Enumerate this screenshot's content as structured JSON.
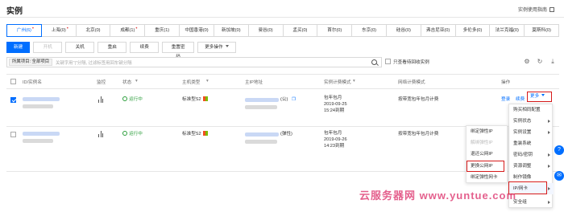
{
  "header": {
    "title": "实例",
    "guide_link": "实例使用指南"
  },
  "regions": [
    {
      "label": "广州(6)",
      "active": true,
      "dot": true
    },
    {
      "label": "上海(0)",
      "active": false,
      "dot": true
    },
    {
      "label": "北京(0)",
      "active": false,
      "dot": false
    },
    {
      "label": "成都(1)",
      "active": false,
      "dot": true
    },
    {
      "label": "重庆(1)",
      "active": false,
      "dot": false
    },
    {
      "label": "中国香港(0)",
      "active": false,
      "dot": false
    },
    {
      "label": "新加坡(0)",
      "active": false,
      "dot": false
    },
    {
      "label": "曼谷(0)",
      "active": false,
      "dot": false
    },
    {
      "label": "孟买(0)",
      "active": false,
      "dot": false
    },
    {
      "label": "首尔(0)",
      "active": false,
      "dot": false
    },
    {
      "label": "东京(0)",
      "active": false,
      "dot": false
    },
    {
      "label": "硅谷(0)",
      "active": false,
      "dot": false
    },
    {
      "label": "弗吉尼亚(0)",
      "active": false,
      "dot": false
    },
    {
      "label": "多伦多(0)",
      "active": false,
      "dot": false
    },
    {
      "label": "法兰克福(0)",
      "active": false,
      "dot": false
    },
    {
      "label": "莫斯科(0)",
      "active": false,
      "dot": false
    }
  ],
  "toolbar": {
    "new": "新建",
    "power_on": "开机",
    "power_off": "关机",
    "restart": "重启",
    "renew": "续费",
    "reset_password": "重置密码",
    "more_ops": "更多操作"
  },
  "filter": {
    "tag": "所属项目: 全部项目",
    "placeholder": "关键字用\"|\"分隔, 过滤标签用回车键分隔",
    "only_expire": "只查看待回收实例"
  },
  "table": {
    "headers": {
      "id_name": "ID/实例名",
      "monitor": "监控",
      "status": "状态",
      "host_type": "主机类型",
      "main_ip": "主IP地址",
      "billing": "实例计费模式",
      "network_billing": "网络计费模式",
      "actions": "操作"
    },
    "rows": [
      {
        "status": "运行中",
        "host_type": "标准型S2",
        "ip_suffix": "(公)",
        "billing_mode": "包年包月",
        "date": "2019-09-25",
        "expire": "15:24到期",
        "network": "按带宽包年包月计费",
        "login": "登录",
        "renew": "续费",
        "more": "更多"
      },
      {
        "status": "运行中",
        "host_type": "标准型S2",
        "ip_suffix": "(弹性)",
        "billing_mode": "包年包月",
        "date": "2019-09-26",
        "expire": "14:23到期",
        "network": "按带宽包年包月计费"
      }
    ]
  },
  "more_menu": {
    "items": [
      {
        "label": "购买相同配置",
        "arrow": false
      },
      {
        "label": "实例状态",
        "arrow": true
      },
      {
        "label": "实例设置",
        "arrow": true
      },
      {
        "label": "重装系统",
        "arrow": false
      },
      {
        "label": "密码/密钥",
        "arrow": true
      },
      {
        "label": "资源调整",
        "arrow": true
      },
      {
        "label": "制作镜像",
        "arrow": false
      },
      {
        "label": "IP/网卡",
        "arrow": true
      },
      {
        "label": "安全组",
        "arrow": true
      }
    ]
  },
  "ip_submenu": {
    "items": [
      {
        "label": "绑定弹性IP",
        "disabled": false
      },
      {
        "label": "解绑弹性IP",
        "disabled": true
      },
      {
        "label": "退还公网IP",
        "disabled": false
      },
      {
        "label": "更换公网IP",
        "disabled": false
      },
      {
        "label": "绑定弹性网卡",
        "disabled": false
      }
    ]
  },
  "watermark": "云服务器网 www.yuntue.com",
  "colors": {
    "primary": "#006eff",
    "running": "#2a9d3a",
    "highlight": "#d61a1a"
  }
}
